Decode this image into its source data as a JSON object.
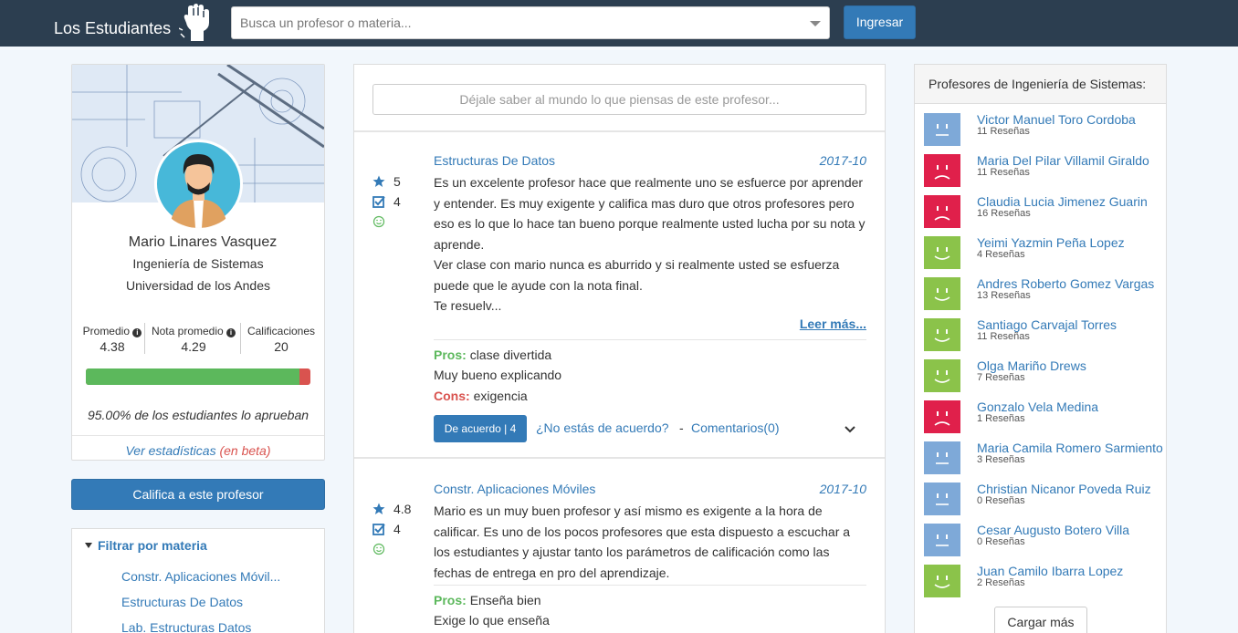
{
  "nav": {
    "brand": "Los Estudiantes",
    "search_placeholder": "Busca un profesor o materia...",
    "login_label": "Ingresar"
  },
  "profile": {
    "name": "Mario Linares Vasquez",
    "department": "Ingeniería de Sistemas",
    "university": "Universidad de los Andes",
    "stats": [
      {
        "label": "Promedio",
        "value": "4.38"
      },
      {
        "label": "Nota promedio",
        "value": "4.29"
      },
      {
        "label": "Calificaciones",
        "value": "20"
      }
    ],
    "approval_fraction": 0.95,
    "approval_text": "95.00% de los estudiantes lo aprueban",
    "stats_link": "Ver estadísticas",
    "beta_label": "(en beta)"
  },
  "rate_button": "Califica a este profesor",
  "filter": {
    "title": "Filtrar por materia",
    "items": [
      "Constr. Aplicaciones Móvil...",
      "Estructuras De Datos",
      "Lab. Estructuras Datos"
    ]
  },
  "opinion_placeholder": "Déjale saber al mundo lo que piensas de este profesor...",
  "reviews": [
    {
      "course": "Estructuras De Datos",
      "date": "2017-10",
      "rating": "5",
      "difficulty": "4",
      "text": "Es un excelente profesor hace que realmente uno se esfuerce por aprender y entender. Es muy exigente y califica mas duro que otros profesores pero eso es lo que lo hace tan bueno porque realmente usted lucha por su nota y aprende.\nVer clase con mario nunca es aburrido y si realmente usted se esfuerza puede que le ayude con la nota final.\nTe resuelv...",
      "read_more": "Leer más...",
      "pros_label": "Pros:",
      "pros": "clase divertida",
      "pros_extra": "Muy bueno explicando",
      "cons_label": "Cons:",
      "cons": "exigencia",
      "agree": "De acuerdo | 4",
      "disagree": "¿No estás de acuerdo?",
      "separator": "-",
      "comments": "Comentarios(0)"
    },
    {
      "course": "Constr. Aplicaciones Móviles",
      "date": "2017-10",
      "rating": "4.8",
      "difficulty": "4",
      "text": "Mario es un muy buen profesor y así mismo es exigente a la hora de calificar. Es uno de los pocos profesores que esta dispuesto a escuchar a los estudiantes y ajustar tanto los parámetros de calificación como las fechas de entrega en pro del aprendizaje.",
      "pros_label": "Pros:",
      "pros": "Enseña bien",
      "pros_extra": "Exige lo que enseña"
    }
  ],
  "sidebar": {
    "title": "Profesores de Ingeniería de Sistemas:",
    "load_more": "Cargar más",
    "professors": [
      {
        "name": "Victor Manuel Toro Cordoba",
        "reviews": "11 Reseñas",
        "mood": "neutral",
        "color": "#7ea9d8"
      },
      {
        "name": "Maria Del Pilar Villamil Giraldo",
        "reviews": "11 Reseñas",
        "mood": "sad",
        "color": "#e0204b"
      },
      {
        "name": "Claudia Lucia Jimenez Guarin",
        "reviews": "16 Reseñas",
        "mood": "sad",
        "color": "#e0204b"
      },
      {
        "name": "Yeimi Yazmin Peña Lopez",
        "reviews": "4 Reseñas",
        "mood": "happy",
        "color": "#8bc34a"
      },
      {
        "name": "Andres Roberto Gomez Vargas",
        "reviews": "13 Reseñas",
        "mood": "happy",
        "color": "#8bc34a"
      },
      {
        "name": "Santiago Carvajal Torres",
        "reviews": "11 Reseñas",
        "mood": "happy",
        "color": "#8bc34a"
      },
      {
        "name": "Olga Mariño Drews",
        "reviews": "7 Reseñas",
        "mood": "happy",
        "color": "#8bc34a"
      },
      {
        "name": "Gonzalo Vela Medina",
        "reviews": "1 Reseñas",
        "mood": "sad",
        "color": "#e0204b"
      },
      {
        "name": "Maria Camila Romero Sarmiento",
        "reviews": "3 Reseñas",
        "mood": "neutral",
        "color": "#7ea9d8"
      },
      {
        "name": "Christian Nicanor Poveda Ruiz",
        "reviews": "0 Reseñas",
        "mood": "neutral",
        "color": "#7ea9d8"
      },
      {
        "name": "Cesar Augusto Botero Villa",
        "reviews": "0 Reseñas",
        "mood": "neutral",
        "color": "#7ea9d8"
      },
      {
        "name": "Juan Camilo Ibarra Lopez",
        "reviews": "2 Reseñas",
        "mood": "happy",
        "color": "#8bc34a"
      }
    ]
  },
  "colors": {
    "navbar": "#2c3e50",
    "primary": "#337ab7",
    "success": "#5cb85c",
    "danger": "#d9534f"
  }
}
